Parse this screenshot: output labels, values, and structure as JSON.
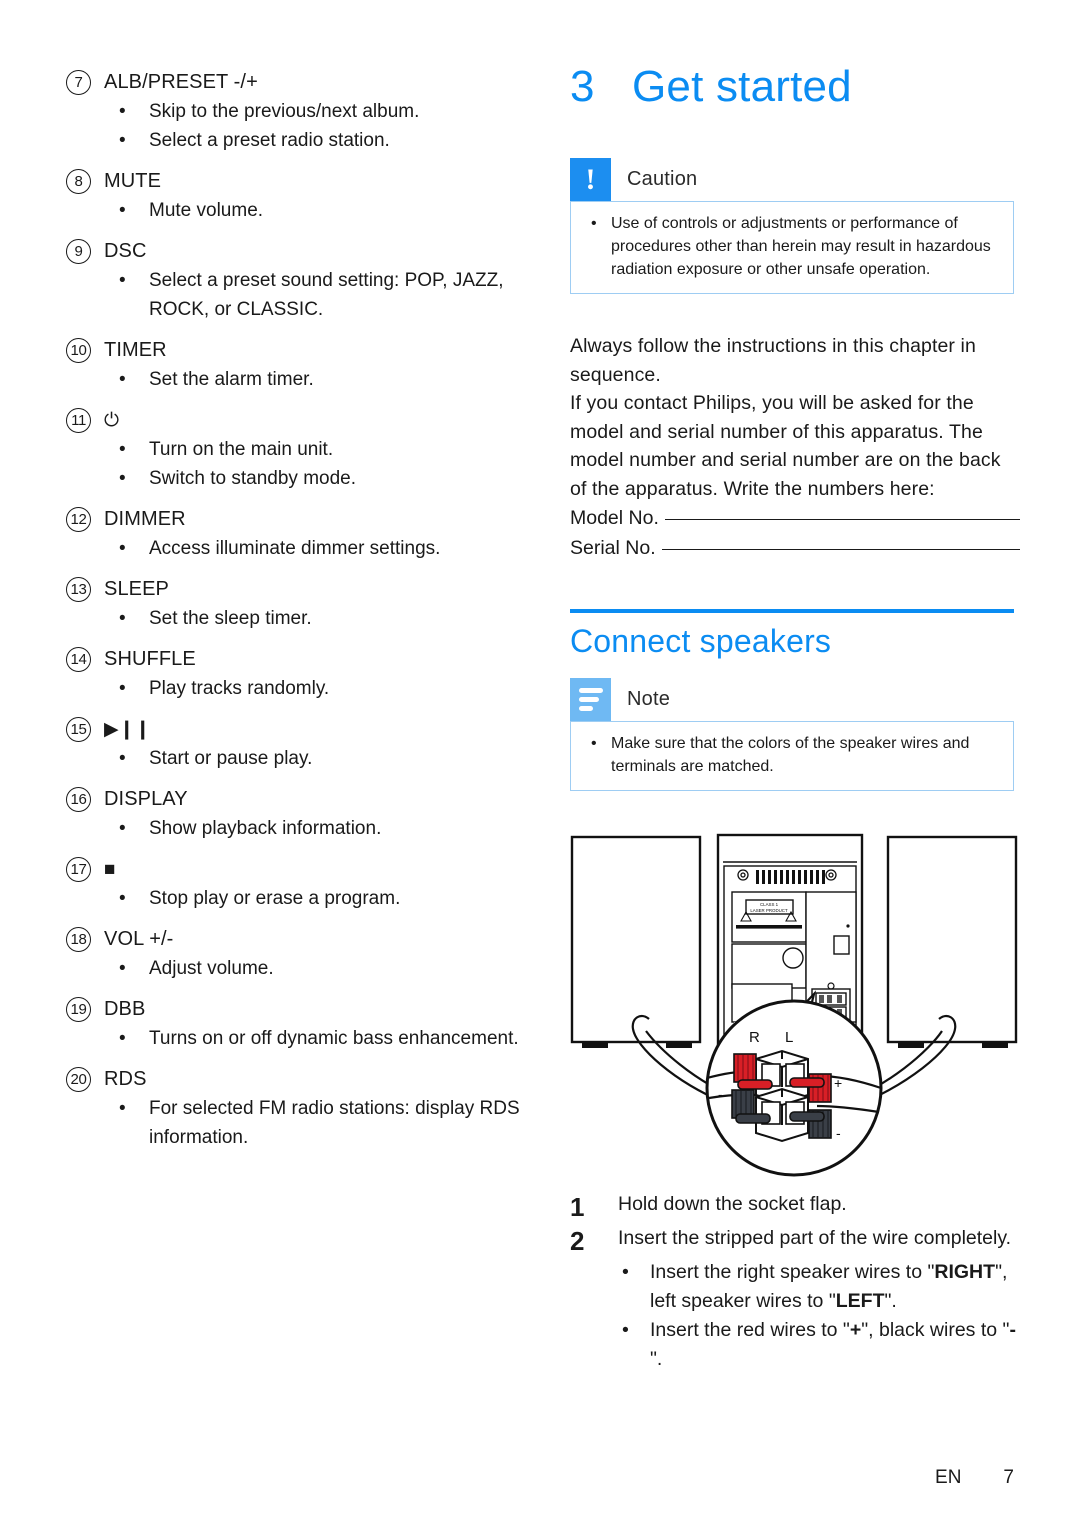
{
  "controls": [
    {
      "num": "7",
      "title": "ALB/PRESET -/+",
      "icon": null,
      "bullets": [
        "Skip to the previous/next album.",
        "Select a preset radio station."
      ]
    },
    {
      "num": "8",
      "title": "MUTE",
      "icon": null,
      "bullets": [
        "Mute volume."
      ]
    },
    {
      "num": "9",
      "title": "DSC",
      "icon": null,
      "bullets": [
        "Select a preset sound setting: POP, JAZZ, ROCK, or CLASSIC."
      ]
    },
    {
      "num": "10",
      "title": "TIMER",
      "icon": null,
      "bullets": [
        "Set the alarm timer."
      ]
    },
    {
      "num": "11",
      "title": "⏻",
      "icon": "power-icon",
      "bullets": [
        "Turn on the main unit.",
        "Switch to standby mode."
      ]
    },
    {
      "num": "12",
      "title": "DIMMER",
      "icon": null,
      "bullets": [
        "Access illuminate dimmer settings."
      ]
    },
    {
      "num": "13",
      "title": "SLEEP",
      "icon": null,
      "bullets": [
        "Set the sleep timer."
      ]
    },
    {
      "num": "14",
      "title": "SHUFFLE",
      "icon": null,
      "bullets": [
        "Play tracks randomly."
      ]
    },
    {
      "num": "15",
      "title": "▶❙❙",
      "icon": "play-pause-icon",
      "bullets": [
        "Start or pause play."
      ]
    },
    {
      "num": "16",
      "title": "DISPLAY",
      "icon": null,
      "bullets": [
        "Show playback information."
      ]
    },
    {
      "num": "17",
      "title": "■",
      "icon": "stop-icon",
      "bullets": [
        "Stop play or erase a program."
      ]
    },
    {
      "num": "18",
      "title": "VOL +/-",
      "icon": null,
      "bullets": [
        "Adjust volume."
      ]
    },
    {
      "num": "19",
      "title": "DBB",
      "icon": null,
      "bullets": [
        "Turns on or off dynamic bass enhancement."
      ]
    },
    {
      "num": "20",
      "title": "RDS",
      "icon": null,
      "bullets": [
        "For selected FM radio stations: display RDS information."
      ]
    }
  ],
  "chapter": {
    "number": "3",
    "title": "Get started"
  },
  "caution": {
    "label": "Caution",
    "icon": "exclamation-icon",
    "items": [
      "Use of controls or adjustments or performance of procedures other than herein may result in hazardous radiation exposure or other unsafe operation."
    ]
  },
  "intro": {
    "p1": "Always follow the instructions in this chapter in sequence.",
    "p2": "If you contact Philips, you will be asked for the model and serial number of this apparatus. The model number and serial number are on the back of the apparatus. Write the numbers here:",
    "model_label": "Model No.",
    "model_value": "",
    "serial_label": "Serial No.",
    "serial_value": ""
  },
  "section": {
    "title": "Connect speakers"
  },
  "note": {
    "label": "Note",
    "icon": "note-lines-icon",
    "items": [
      "Make sure that the colors of the speaker wires and terminals are matched."
    ]
  },
  "diagram": {
    "name": "speaker-wiring-diagram",
    "labels": {
      "right": "R",
      "left": "L",
      "plus": "+",
      "minus_left": "-",
      "minus_right": "-"
    },
    "unit_label_line1": "CLASS 1",
    "unit_label_line2": "LASER PRODUCT",
    "colors": {
      "red_terminal": "#d81f26",
      "black_terminal": "#3a3f47",
      "outline": "#111111"
    }
  },
  "steps": [
    {
      "num": "1",
      "text": "Hold down the socket flap.",
      "substeps": []
    },
    {
      "num": "2",
      "text": "Insert the stripped part of the wire completely.",
      "substeps": [
        {
          "pre": "Insert the right speaker wires to \"",
          "b1": "RIGHT",
          "mid": "\", left speaker wires to \"",
          "b2": "LEFT",
          "post": "\"."
        },
        {
          "pre": "Insert the red wires to \"",
          "b1": "+",
          "mid": "\", black wires to \"",
          "b2": "-",
          "post": "\"."
        }
      ]
    }
  ],
  "footer": {
    "language": "EN",
    "page": "7"
  },
  "theme": {
    "accent": "#0b8cf2",
    "note_accent": "#6fb9f3",
    "caution_accent": "#1c8ef0",
    "text": "#1a1a1a"
  }
}
